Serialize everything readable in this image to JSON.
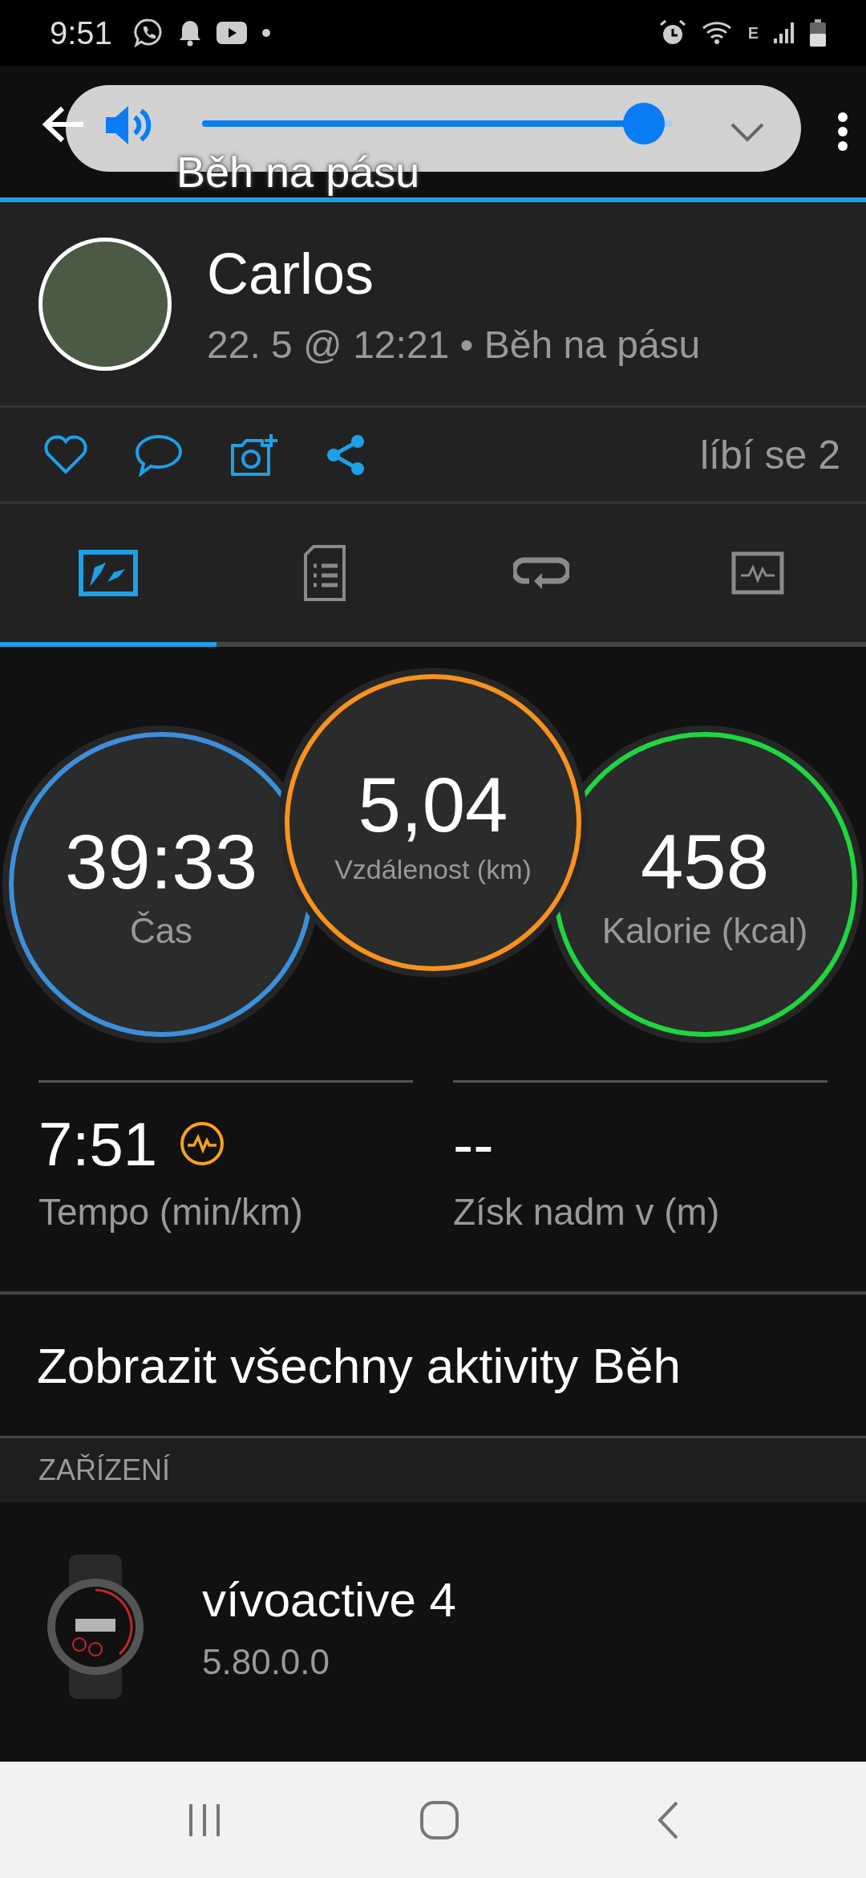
{
  "status_bar": {
    "time": "9:51",
    "network_type": "E"
  },
  "app_bar": {
    "title": "Běh na pásu"
  },
  "volume_panel": {
    "level": 0.94
  },
  "profile": {
    "name": "Carlos",
    "subtitle": "22. 5 @ 12:21 • Běh na pásu"
  },
  "actions": {
    "likes": "líbí se 2"
  },
  "tabs": [
    {
      "kind": "summary",
      "selected": true
    },
    {
      "kind": "details",
      "selected": false
    },
    {
      "kind": "laps",
      "selected": false
    },
    {
      "kind": "chart",
      "selected": false
    }
  ],
  "metrics": [
    {
      "value": "39:33",
      "label": "Čas",
      "color": "#3d8fd9"
    },
    {
      "value": "5,04",
      "label": "Vzdálenost (km)",
      "color": "#f7921e"
    },
    {
      "value": "458",
      "label": "Kalorie (kcal)",
      "color": "#1fd640"
    }
  ],
  "stats": [
    {
      "value": "7:51",
      "label": "Tempo (min/km)",
      "badge": true
    },
    {
      "value": "--",
      "label": "Získ nadm v (m)",
      "badge": false
    }
  ],
  "link": "Zobrazit všechny aktivity Běh",
  "section_header": "ZAŘÍZENÍ",
  "device": {
    "name": "vívoactive 4",
    "version": "5.80.0.0"
  }
}
